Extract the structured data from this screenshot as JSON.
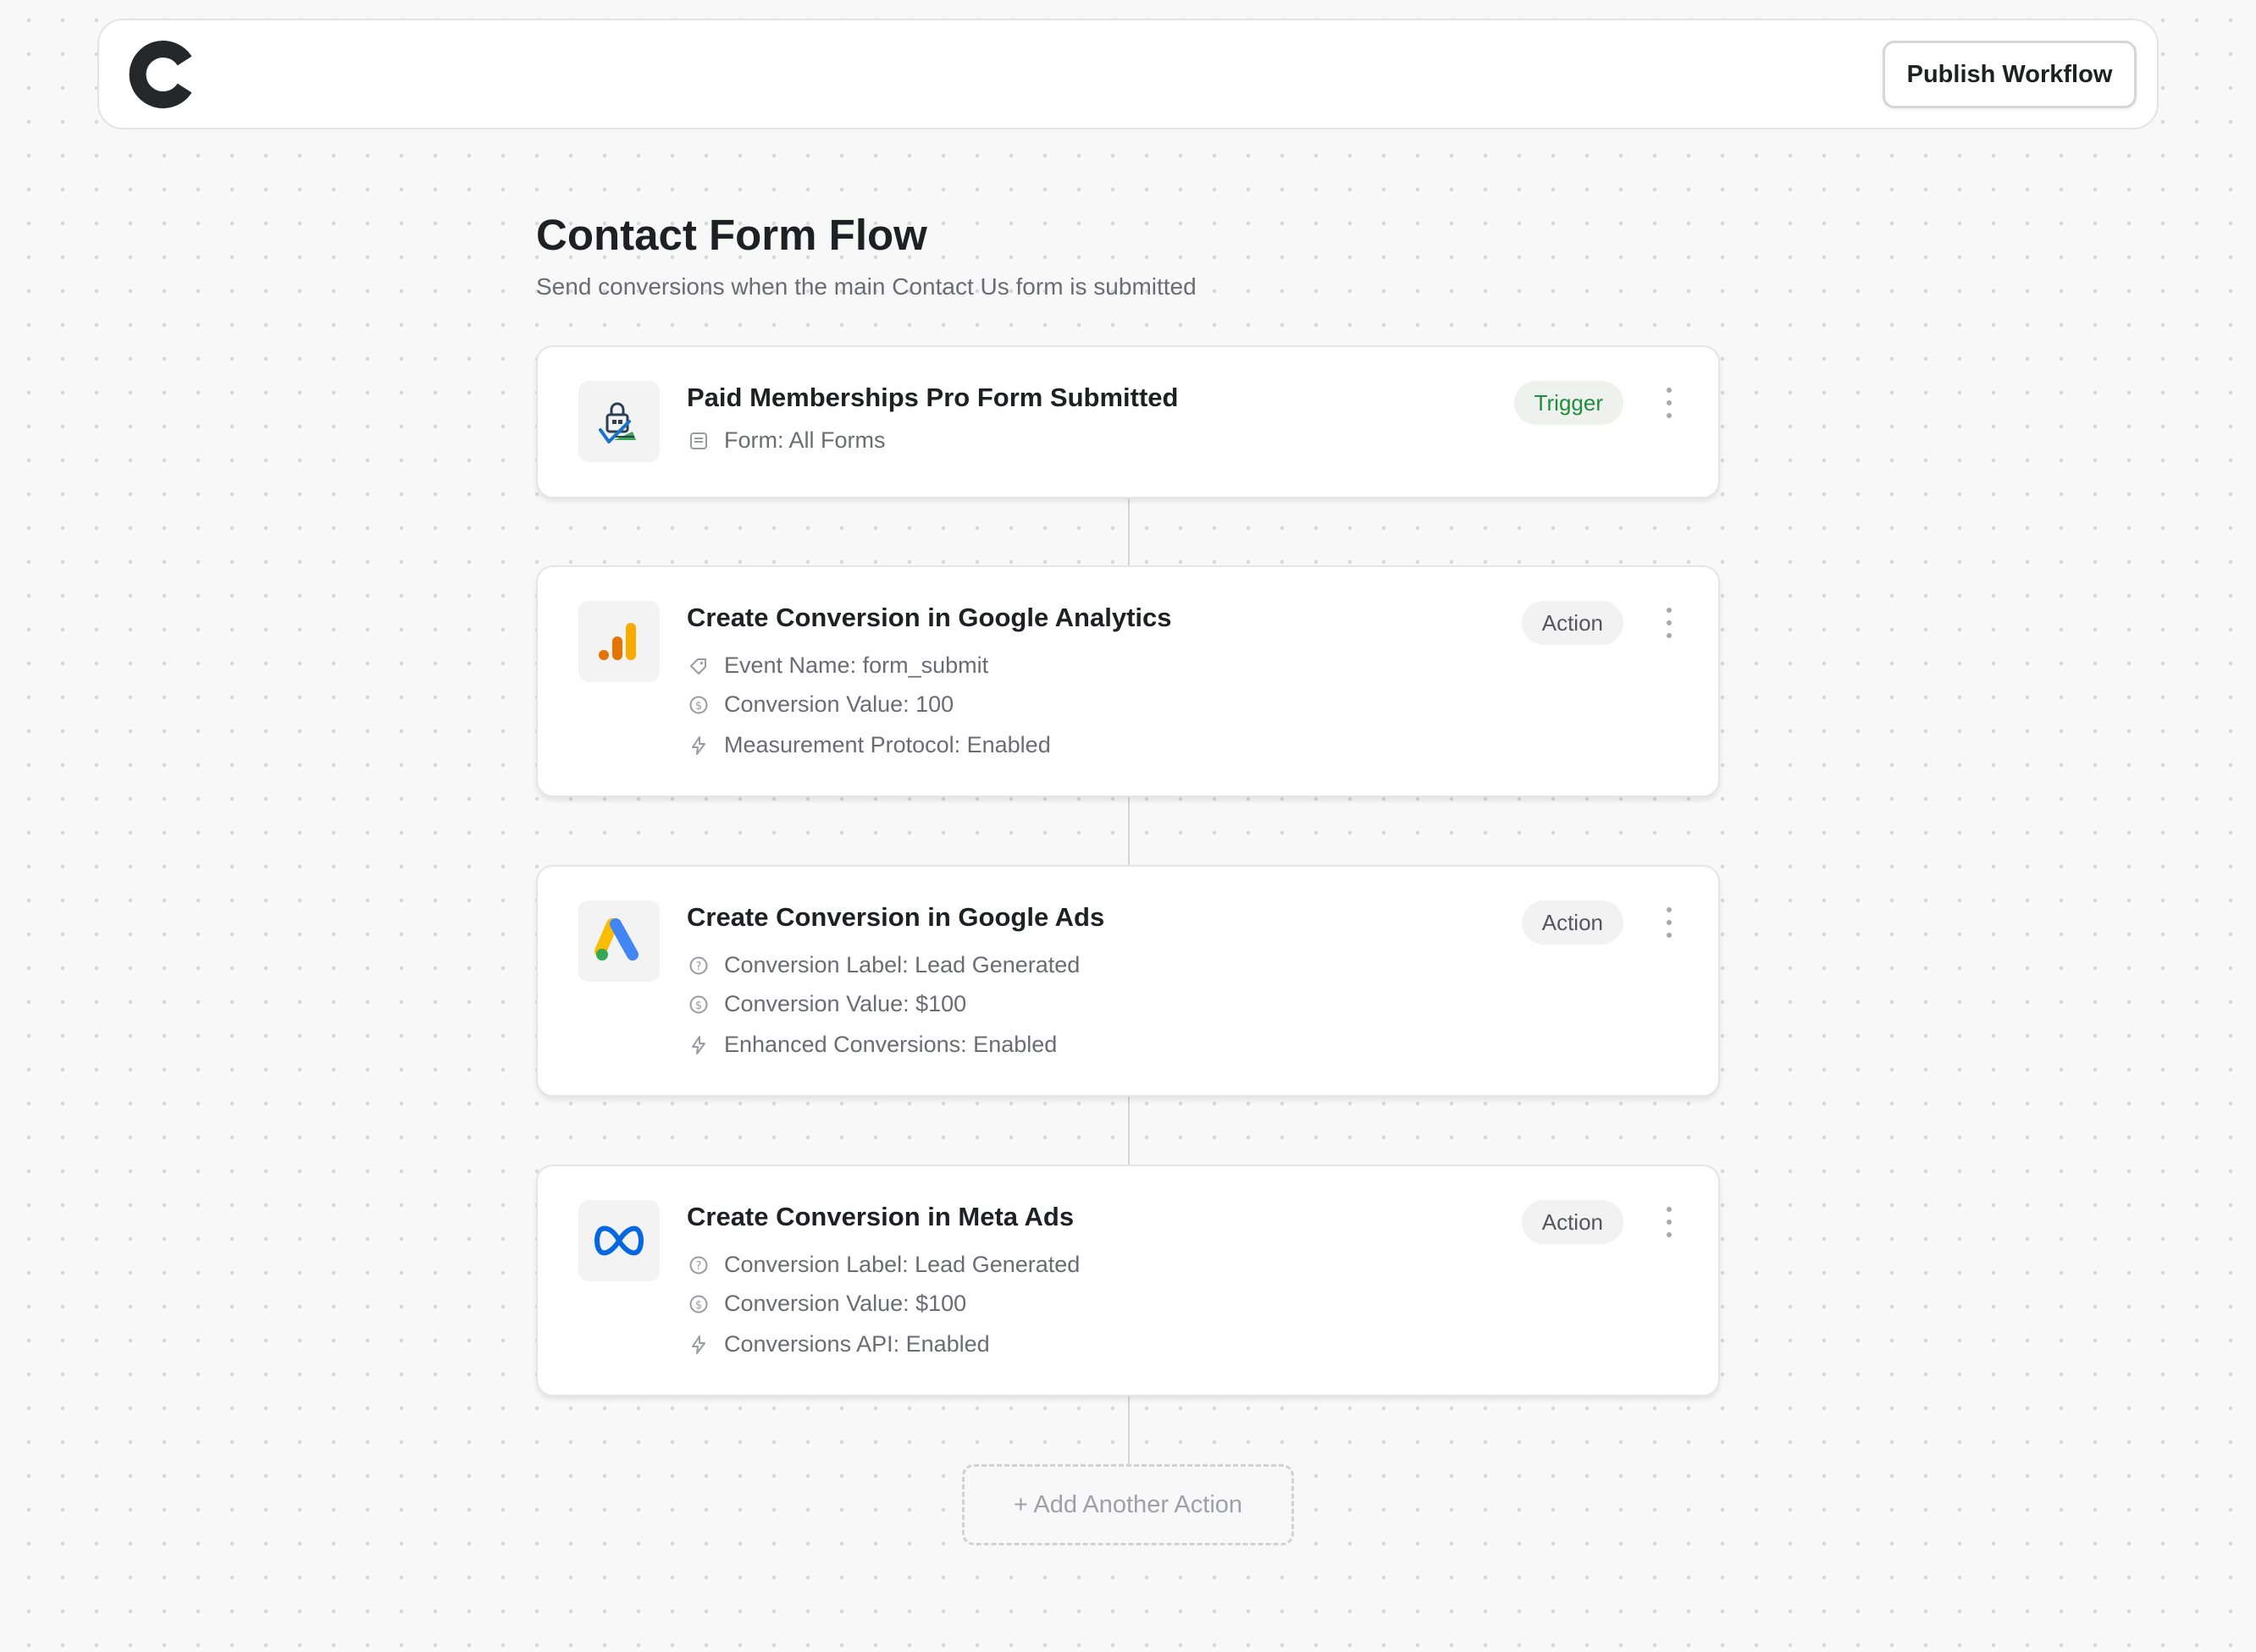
{
  "header": {
    "logo_icon": "c-logo-icon",
    "publish_label": "Publish Workflow"
  },
  "workflow": {
    "title": "Contact Form Flow",
    "subtitle": "Send conversions when the main Contact Us form is submitted"
  },
  "steps": [
    {
      "title": "Paid Memberships Pro Form Submitted",
      "badge": "Trigger",
      "icon": "paid-memberships-pro-icon",
      "details": [
        {
          "icon": "form-icon",
          "text": "Form: All Forms"
        }
      ]
    },
    {
      "title": "Create Conversion in Google Analytics",
      "badge": "Action",
      "icon": "google-analytics-icon",
      "details": [
        {
          "icon": "tag-icon",
          "text": "Event Name: form_submit"
        },
        {
          "icon": "dollar-circle-icon",
          "text": "Conversion Value: 100"
        },
        {
          "icon": "lightning-icon",
          "text": "Measurement Protocol: Enabled"
        }
      ]
    },
    {
      "title": "Create Conversion in Google Ads",
      "badge": "Action",
      "icon": "google-ads-icon",
      "details": [
        {
          "icon": "help-circle-icon",
          "text": "Conversion Label: Lead Generated"
        },
        {
          "icon": "dollar-circle-icon",
          "text": "Conversion Value: $100"
        },
        {
          "icon": "lightning-icon",
          "text": "Enhanced Conversions: Enabled"
        }
      ]
    },
    {
      "title": "Create Conversion in Meta Ads",
      "badge": "Action",
      "icon": "meta-icon",
      "details": [
        {
          "icon": "help-circle-icon",
          "text": "Conversion Label: Lead Generated"
        },
        {
          "icon": "dollar-circle-icon",
          "text": "Conversion Value: $100"
        },
        {
          "icon": "lightning-icon",
          "text": "Conversions API: Enabled"
        }
      ]
    }
  ],
  "add_action_label": "+ Add Another Action",
  "colors": {
    "trigger_badge_text": "#1e8e3e",
    "background": "#f8f8f8",
    "card_border": "#e5e5e5",
    "meta_blue": "#0668e1",
    "ga_orange": "#f9ab00",
    "ga_dark_orange": "#e37400",
    "ads_blue": "#4285f4",
    "ads_yellow": "#fbbc04",
    "ads_green": "#34a853"
  }
}
